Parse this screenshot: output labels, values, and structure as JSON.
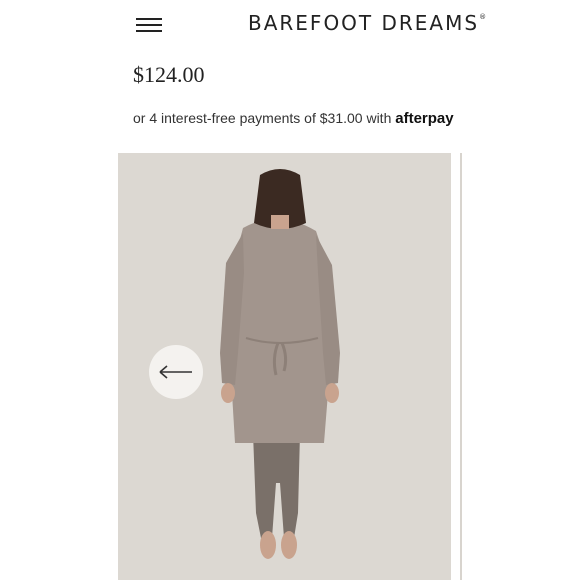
{
  "header": {
    "brand_logo": "BAREFOOT DREAMS",
    "brand_mark": "®",
    "menu_icon": "hamburger-menu-icon"
  },
  "product": {
    "price": "$124.00",
    "payments_prefix": "or 4 interest-free payments of $31.00 with ",
    "payments_brand": "afterpay"
  },
  "gallery": {
    "prev_icon": "arrow-left-icon",
    "colors": {
      "background": "#dcd8d2",
      "cardigan": "#a2958d",
      "leggings": "#7a7069",
      "hair": "#3b2a22",
      "skin": "#c9a38e"
    }
  }
}
